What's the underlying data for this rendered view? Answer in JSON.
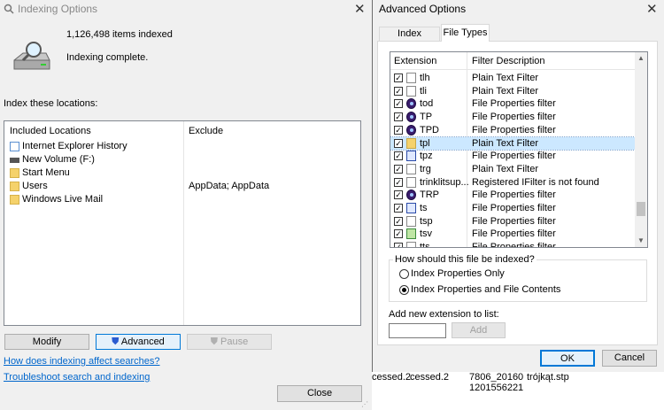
{
  "indexing_window": {
    "title": "Indexing Options",
    "items_indexed": "1,126,498 items indexed",
    "status": "Indexing complete.",
    "locations_heading": "Index these locations:",
    "columns": {
      "included": "Included Locations",
      "exclude": "Exclude"
    },
    "locations": [
      {
        "name": "Internet Explorer History",
        "exclude": "",
        "icon": "ie-history-icon"
      },
      {
        "name": "New Volume (F:)",
        "exclude": "",
        "icon": "drive-icon"
      },
      {
        "name": "Start Menu",
        "exclude": "",
        "icon": "folder-icon"
      },
      {
        "name": "Users",
        "exclude": "AppData; AppData",
        "icon": "folder-icon"
      },
      {
        "name": "Windows Live Mail",
        "exclude": "",
        "icon": "folder-icon"
      }
    ],
    "buttons": {
      "modify": "Modify",
      "advanced": "Advanced",
      "pause": "Pause",
      "close": "Close"
    },
    "links": {
      "how": "How does indexing affect searches?",
      "troubleshoot": "Troubleshoot search and indexing"
    }
  },
  "advanced_window": {
    "title": "Advanced Options",
    "tabs": [
      "Index Settings",
      "File Types"
    ],
    "active_tab": "File Types",
    "columns": {
      "extension": "Extension",
      "filter": "Filter Description"
    },
    "file_types": [
      {
        "ext": "tlh",
        "filter": "Plain Text Filter",
        "icon": "doc",
        "checked": true,
        "selected": false
      },
      {
        "ext": "tli",
        "filter": "Plain Text Filter",
        "icon": "doc",
        "checked": true,
        "selected": false
      },
      {
        "ext": "tod",
        "filter": "File Properties filter",
        "icon": "eye",
        "checked": true,
        "selected": false
      },
      {
        "ext": "TP",
        "filter": "File Properties filter",
        "icon": "eye",
        "checked": true,
        "selected": false
      },
      {
        "ext": "TPD",
        "filter": "File Properties filter",
        "icon": "eye",
        "checked": true,
        "selected": false
      },
      {
        "ext": "tpl",
        "filter": "Plain Text Filter",
        "icon": "folder",
        "checked": true,
        "selected": true
      },
      {
        "ext": "tpz",
        "filter": "File Properties filter",
        "icon": "blue",
        "checked": true,
        "selected": false
      },
      {
        "ext": "trg",
        "filter": "Plain Text Filter",
        "icon": "doc",
        "checked": true,
        "selected": false
      },
      {
        "ext": "trinklitsup...",
        "filter": "Registered IFilter is not found",
        "icon": "doc",
        "checked": true,
        "selected": false
      },
      {
        "ext": "TRP",
        "filter": "File Properties filter",
        "icon": "eye",
        "checked": true,
        "selected": false
      },
      {
        "ext": "ts",
        "filter": "File Properties filter",
        "icon": "blue",
        "checked": true,
        "selected": false
      },
      {
        "ext": "tsp",
        "filter": "File Properties filter",
        "icon": "doc",
        "checked": true,
        "selected": false
      },
      {
        "ext": "tsv",
        "filter": "File Properties filter",
        "icon": "green",
        "checked": true,
        "selected": false
      },
      {
        "ext": "tts",
        "filter": "File Properties filter",
        "icon": "doc",
        "checked": true,
        "selected": false
      }
    ],
    "index_group": {
      "label": "How should this file be indexed?",
      "options": [
        "Index Properties Only",
        "Index Properties and File Contents"
      ],
      "selected": "Index Properties and File Contents"
    },
    "add_extension": {
      "label": "Add new extension to list:",
      "value": "",
      "add_button": "Add"
    },
    "buttons": {
      "ok": "OK",
      "cancel": "Cancel"
    },
    "scroll_position_fraction": 0.87
  },
  "background_text": [
    "cessed.2",
    "cessed.2",
    "7806_20160",
    "1201556221",
    "trójkąt.stp"
  ],
  "colors": {
    "accent": "#0078d7",
    "link": "#0066cc",
    "selection": "#cce8ff"
  }
}
